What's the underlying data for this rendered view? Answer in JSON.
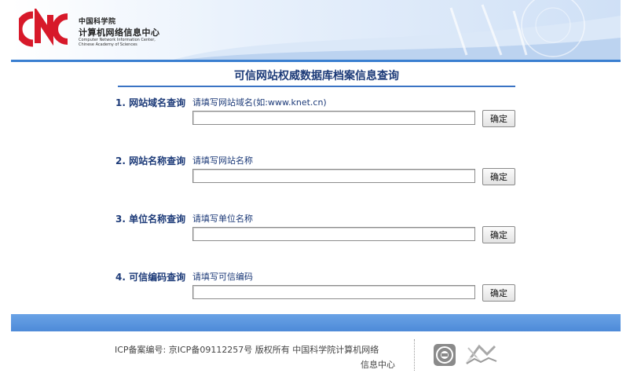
{
  "header": {
    "org_name_cn_line1": "中国科学院",
    "org_name_cn_line2": "计算机网络信息中心",
    "org_name_en_line1": "Computer Network Information Center,",
    "org_name_en_line2": "Chinese Academy of Sciences",
    "logo_text": "CNIC",
    "accent_color": "#3a7fd0",
    "logo_color": "#d7192a"
  },
  "page": {
    "title": "可信网站权威数据库档案信息查询"
  },
  "queries": [
    {
      "label": "1. 网站域名查询",
      "hint": "请填写网站域名(如:www.knet.cn)",
      "value": "",
      "button": "确定"
    },
    {
      "label": "2. 网站名称查询",
      "hint": "请填写网站名称",
      "value": "",
      "button": "确定"
    },
    {
      "label": "3. 单位名称查询",
      "hint": "请填写单位名称",
      "value": "",
      "button": "确定"
    },
    {
      "label": "4. 可信编码查询",
      "hint": "请填写可信编码",
      "value": "",
      "button": "确定"
    }
  ],
  "footer": {
    "line1": "ICP备案编号: 京ICP备09112257号 版权所有 中国科学院计算机网络",
    "line2": "信息中心",
    "badge_1_icon": "certificate-seal-icon",
    "badge_2_icon": "cdec-logo-icon"
  }
}
